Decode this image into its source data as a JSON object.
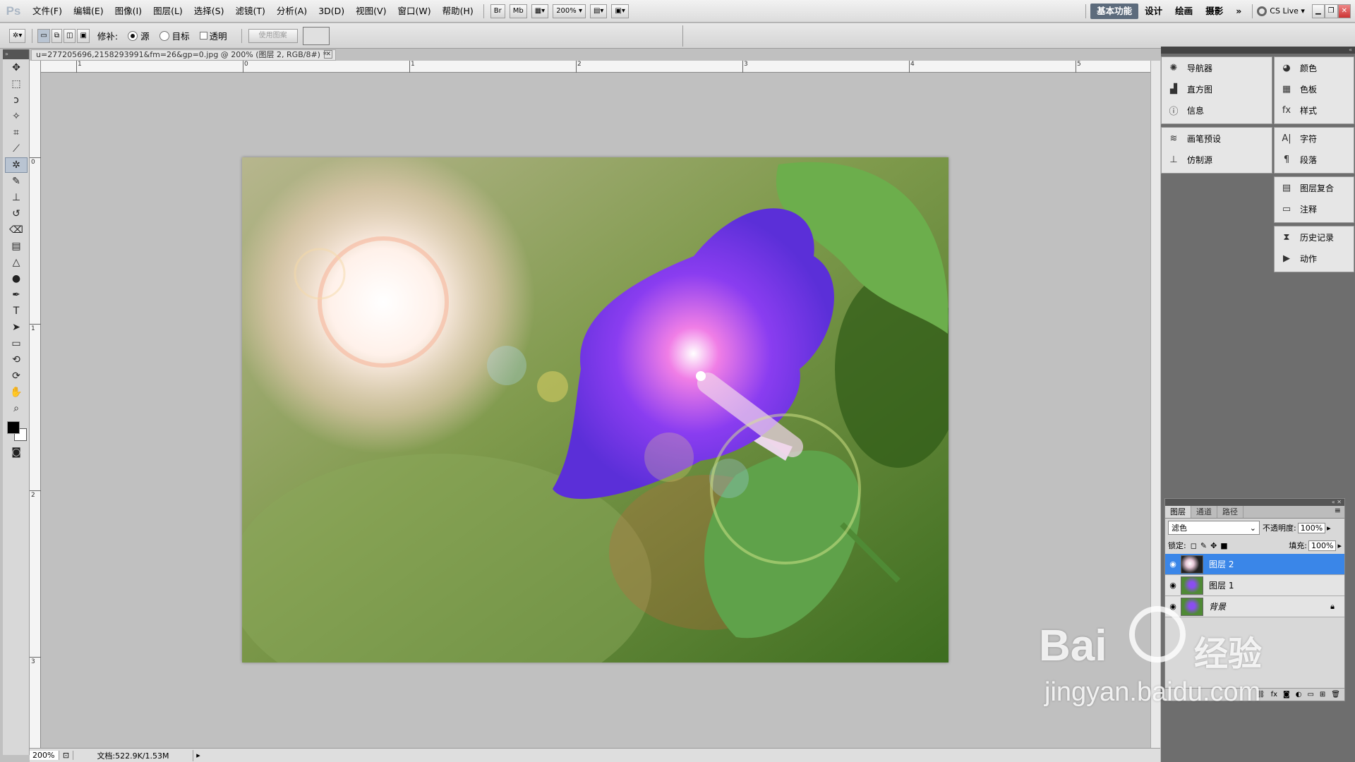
{
  "menubar": {
    "logo": "Ps",
    "menus": [
      "文件(F)",
      "编辑(E)",
      "图像(I)",
      "图层(L)",
      "选择(S)",
      "滤镜(T)",
      "分析(A)",
      "3D(D)",
      "视图(V)",
      "窗口(W)",
      "帮助(H)"
    ],
    "bridge_label": "Br",
    "mini_bridge_label": "Mb",
    "zoom": "200%",
    "workspaces": [
      "基本功能",
      "设计",
      "绘画",
      "摄影"
    ],
    "more": "»",
    "cs_live": "CS Live"
  },
  "options": {
    "patch_label": "修补:",
    "source_label": "源",
    "target_label": "目标",
    "transparent_label": "透明",
    "use_pattern_label": "使用图案"
  },
  "document": {
    "tab_title": "u=277205696,2158293991&fm=26&gp=0.jpg @ 200% (图层 2, RGB/8#) *",
    "ruler_h": [
      "1",
      "0",
      "1",
      "2",
      "3",
      "4",
      "5"
    ],
    "ruler_v": [
      "0",
      "1",
      "2",
      "3"
    ]
  },
  "status": {
    "zoom": "200%",
    "doc_info": "文档:522.9K/1.53M"
  },
  "panels": {
    "col1_group1": [
      "导航器",
      "直方图",
      "信息"
    ],
    "col1_group2": [
      "画笔预设",
      "仿制源"
    ],
    "col2_group1": [
      "颜色",
      "色板",
      "样式"
    ],
    "col2_group2": [
      "字符",
      "段落"
    ],
    "col2_group3": [
      "图层复合",
      "注释"
    ],
    "col2_group4": [
      "历史记录",
      "动作"
    ]
  },
  "layers_panel": {
    "tabs": [
      "图层",
      "通道",
      "路径"
    ],
    "blend_mode": "滤色",
    "opacity_label": "不透明度:",
    "opacity": "100%",
    "lock_label": "锁定:",
    "fill_label": "填充:",
    "fill": "100%",
    "layers": [
      {
        "name": "图层 2",
        "selected": true
      },
      {
        "name": "图层 1",
        "selected": false
      },
      {
        "name": "背景",
        "selected": false
      }
    ]
  },
  "watermark": {
    "brand": "Bai",
    "brand_cn": "经验",
    "url": "jingyan.baidu.com"
  }
}
